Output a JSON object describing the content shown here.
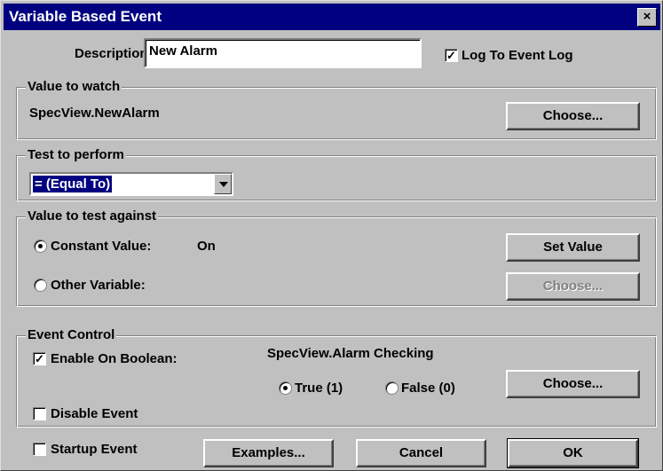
{
  "window": {
    "title": "Variable Based Event",
    "close_glyph": "×"
  },
  "description": {
    "label": "Description:",
    "value": "New Alarm"
  },
  "log_to_event_log": {
    "label": "Log To Event Log",
    "checked": true
  },
  "value_to_watch": {
    "group_title": "Value to watch",
    "variable": "SpecView.NewAlarm",
    "choose_label": "Choose..."
  },
  "test_to_perform": {
    "group_title": "Test to perform",
    "selected": "= (Equal To)"
  },
  "value_to_test_against": {
    "group_title": "Value to test against",
    "constant_label": "Constant Value:",
    "constant_value": "On",
    "set_value_label": "Set Value",
    "other_variable_label": "Other Variable:",
    "choose_label": "Choose...",
    "selected": "constant"
  },
  "event_control": {
    "group_title": "Event Control",
    "enable_on_boolean_label": "Enable On Boolean:",
    "enable_on_boolean_checked": true,
    "boolean_variable": "SpecView.Alarm Checking",
    "true_label": "True (1)",
    "false_label": "False (0)",
    "selected": "true",
    "choose_label": "Choose...",
    "disable_event_label": "Disable Event",
    "disable_event_checked": false
  },
  "footer": {
    "startup_event_label": "Startup Event",
    "startup_event_checked": false,
    "examples_label": "Examples...",
    "cancel_label": "Cancel",
    "ok_label": "OK"
  },
  "check_glyph": "✓"
}
